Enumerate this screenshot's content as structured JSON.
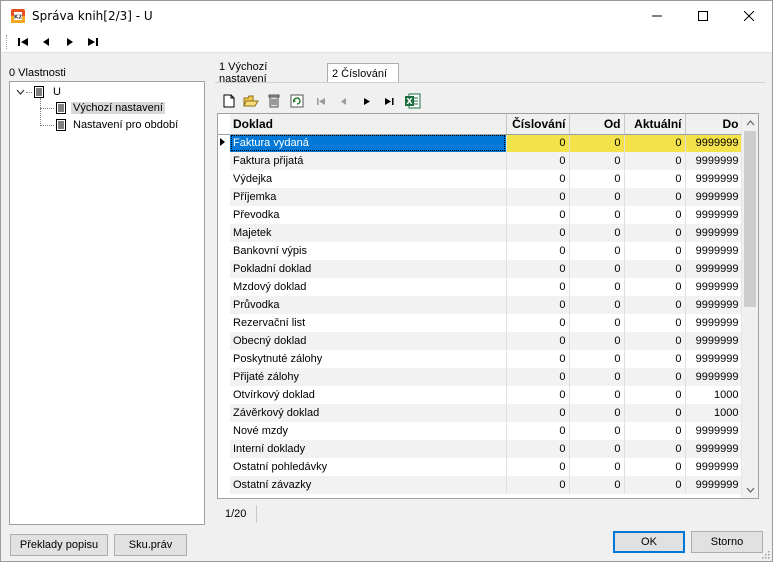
{
  "window": {
    "title": "Správa knih[2/3] - U"
  },
  "left_panel": {
    "caption": "0 Vlastnosti",
    "tree": {
      "root": "U",
      "children": [
        "Výchozí nastavení",
        "Nastavení pro období"
      ]
    },
    "buttons": {
      "translations": "Překlady popisu",
      "rights": "Sku.práv"
    }
  },
  "tabs": [
    "1 Výchozí nastavení",
    "2 Číslování"
  ],
  "grid": {
    "columns": [
      "Doklad",
      "Číslování",
      "Od",
      "Aktuální",
      "Do"
    ],
    "rows": [
      [
        "Faktura vydaná",
        "0",
        "0",
        "0",
        "9999999"
      ],
      [
        "Faktura přijatá",
        "0",
        "0",
        "0",
        "9999999"
      ],
      [
        "Výdejka",
        "0",
        "0",
        "0",
        "9999999"
      ],
      [
        "Příjemka",
        "0",
        "0",
        "0",
        "9999999"
      ],
      [
        "Převodka",
        "0",
        "0",
        "0",
        "9999999"
      ],
      [
        "Majetek",
        "0",
        "0",
        "0",
        "9999999"
      ],
      [
        "Bankovní výpis",
        "0",
        "0",
        "0",
        "9999999"
      ],
      [
        "Pokladní doklad",
        "0",
        "0",
        "0",
        "9999999"
      ],
      [
        "Mzdový doklad",
        "0",
        "0",
        "0",
        "9999999"
      ],
      [
        "Průvodka",
        "0",
        "0",
        "0",
        "9999999"
      ],
      [
        "Rezervační list",
        "0",
        "0",
        "0",
        "9999999"
      ],
      [
        "Obecný doklad",
        "0",
        "0",
        "0",
        "9999999"
      ],
      [
        "Poskytnuté zálohy",
        "0",
        "0",
        "0",
        "9999999"
      ],
      [
        "Přijaté zálohy",
        "0",
        "0",
        "0",
        "9999999"
      ],
      [
        "Otvírkový doklad",
        "0",
        "0",
        "0",
        "1000"
      ],
      [
        "Závěrkový doklad",
        "0",
        "0",
        "0",
        "1000"
      ],
      [
        "Nové mzdy",
        "0",
        "0",
        "0",
        "9999999"
      ],
      [
        "Interní doklady",
        "0",
        "0",
        "0",
        "9999999"
      ],
      [
        "Ostatní pohledávky",
        "0",
        "0",
        "0",
        "9999999"
      ],
      [
        "Ostatní závazky",
        "0",
        "0",
        "0",
        "9999999"
      ]
    ],
    "record_status": "1/20"
  },
  "footer": {
    "ok": "OK",
    "cancel": "Storno"
  },
  "colors": {
    "selection": "#0078d7",
    "highlight": "#f4e24b",
    "alt_row": "#f2f2f2"
  },
  "icons": [
    "app-icon",
    "first-icon",
    "prev-icon",
    "next-icon",
    "last-icon",
    "new-icon",
    "open-icon",
    "delete-icon",
    "refresh-icon",
    "excel-icon"
  ]
}
